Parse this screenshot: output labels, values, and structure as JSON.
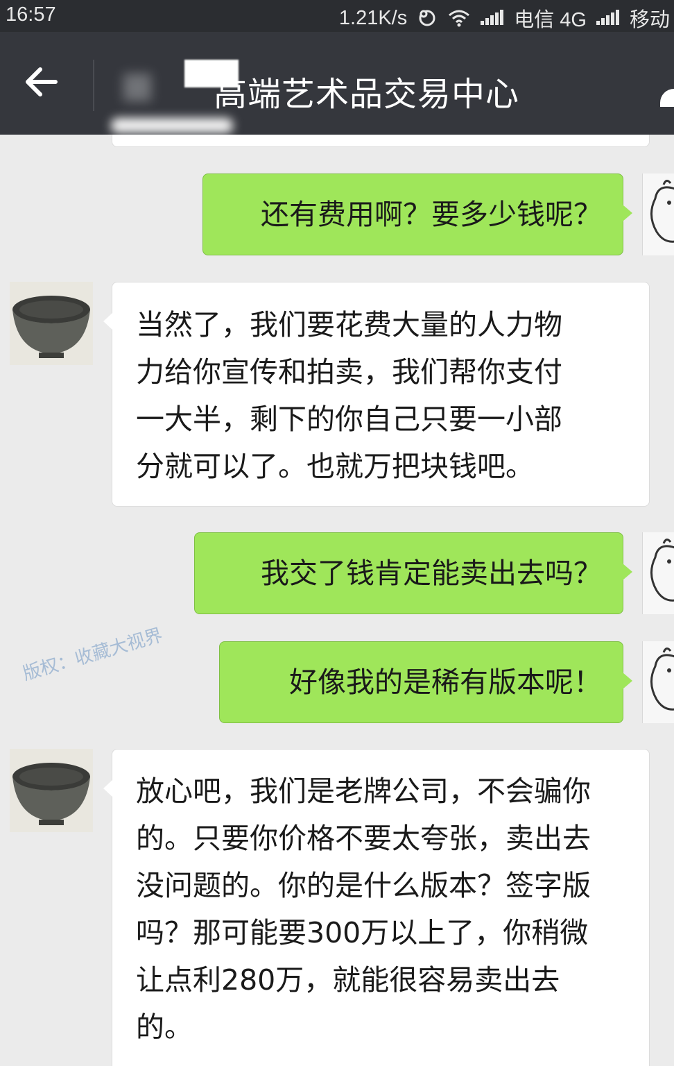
{
  "status_bar": {
    "time": "16:57",
    "network_speed": "1.21K/s",
    "carrier1": "电信 4G",
    "carrier2": "移动"
  },
  "header": {
    "title": "高端艺术品交易中心",
    "back_icon": "back-arrow-icon"
  },
  "messages": [
    {
      "side": "right",
      "text": "还有费用啊？要多少钱呢？"
    },
    {
      "side": "left",
      "lines": [
        "当然了，我们要花费大量的人力物",
        "力给你宣传和拍卖，我们帮你支付",
        "一大半，剩下的你自己只要一小部",
        "分就可以了。也就万把块钱吧。"
      ]
    },
    {
      "side": "right",
      "text": "我交了钱肯定能卖出去吗？"
    },
    {
      "side": "right",
      "text": "好像我的是稀有版本呢！"
    },
    {
      "side": "left",
      "lines": [
        "放心吧，我们是老牌公司，不会骗你",
        "的。只要你价格不要太夸张，卖出去",
        "没问题的。你的是什么版本？签字版",
        "吗？那可能要300万以上了，你稍微",
        "让点利280万，就能很容易卖出去",
        "的。"
      ]
    }
  ],
  "watermark": "版权：收藏大视界",
  "colors": {
    "outgoing_bubble": "#9fe65a",
    "incoming_bubble": "#ffffff",
    "title_bar": "#35373d",
    "chat_background": "#ebebeb"
  }
}
